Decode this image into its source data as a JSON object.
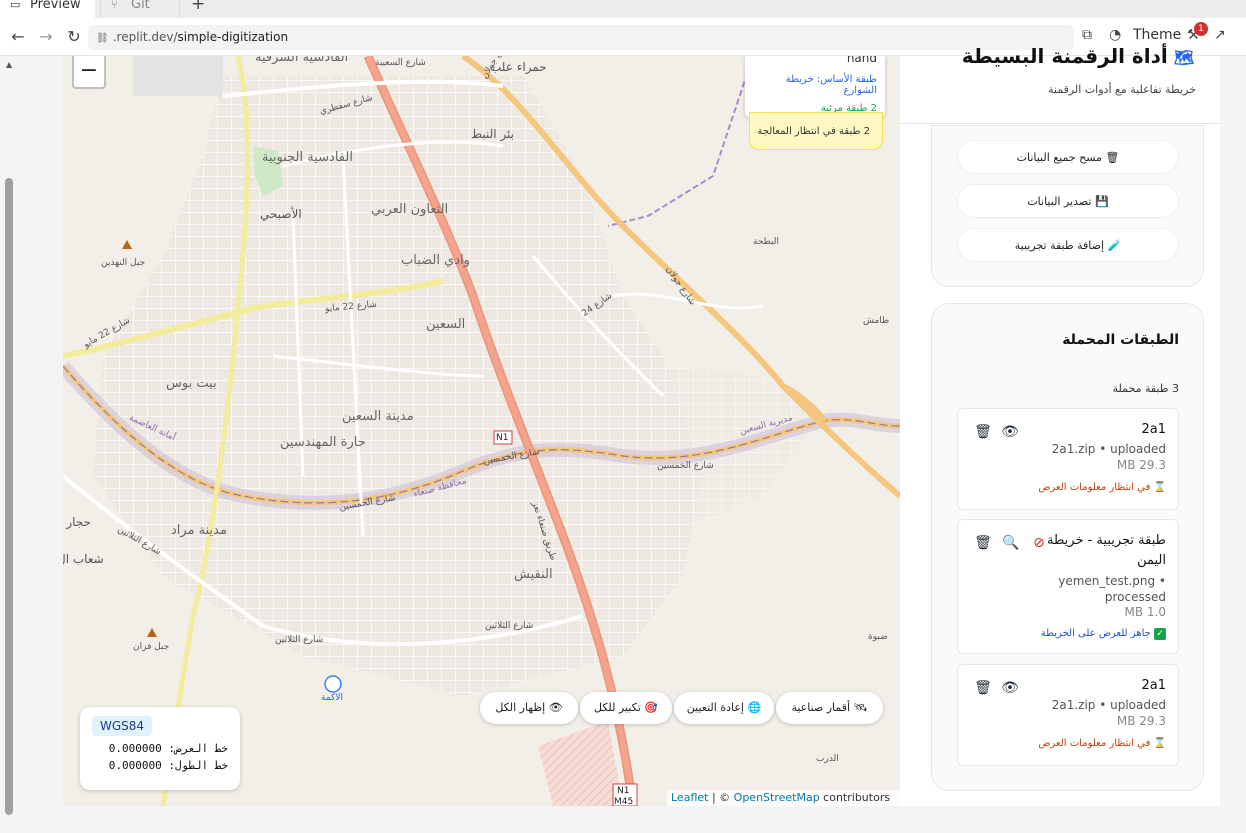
{
  "browser": {
    "tabs": [
      {
        "label": "Preview",
        "icon": "monitor-icon",
        "active": true
      },
      {
        "label": "Git",
        "icon": "git-icon",
        "active": false
      }
    ],
    "url_prefix": ".replit.dev/",
    "url_path": "simple-digitization",
    "theme_label": "Theme",
    "notification_count": "1"
  },
  "map": {
    "zoom_out": "−",
    "info_card": {
      "line1": "hand",
      "line2": "طبقة الأساس: خريطة الشوارع",
      "line3": "2 طبقة مرئية"
    },
    "pending_card": "2 طبقة في انتظار المعالجة",
    "buttons": {
      "show_all": "إظهار الكل",
      "fit_all": "تكبير للكل",
      "reset": "إعادة التعيين",
      "satellite": "أقمار صناعية"
    },
    "coords": {
      "crs": "WGS84",
      "lat_label": "خط العرض:",
      "lat_value": "0.000000",
      "lon_label": "خط الطول:",
      "lon_value": "0.000000"
    },
    "attribution": {
      "leaflet": "Leaflet",
      "sep": " | © ",
      "osm": "OpenStreetMap",
      "contributors": " contributors"
    },
    "labels": {
      "qadisiya_east": "القادسية الشرقية",
      "sawadi_st": "شارع السعيبة",
      "hamra_alab": "حمراء علب",
      "jolan_st": "شارع جولان",
      "sattary_st": "شارع سفطري",
      "bir_nabt": "بئر النبط",
      "qadisiya_south": "القادسية الجنوبية",
      "asbahi": "الأصبحي",
      "taawun": "التعاون العربي",
      "jabal_nahdain": "جبل النهدين",
      "wadi_dhabab": "وادي الضباب",
      "batha": "البطحة",
      "st_22_may": "شارع 22 مايو",
      "st_22_may_2": "شارع 22 مايو",
      "saween": "السعين",
      "tamesh": "طامش",
      "bait_bous": "بيت بوس",
      "saween_city": "مدينة السعين",
      "engineers": "حارة المهندسين",
      "capital": "أمانة العاصمة",
      "saween_dir": "مديرية السعين",
      "fifties_st": "شارع الخمسين",
      "fifties_st2": "شارع الخمسين",
      "fifties_st3": "شارع الخمسين",
      "sanaa_gov": "محافظة صنعاء",
      "hajar": "حجار نو",
      "murad": "مدينة مراد",
      "shaab": "شعاب ال",
      "nuqaish": "النقيش",
      "thalatheen": "شارع الثلاثين",
      "thalatheen2": "شارع الثلاثين",
      "thalatheen3": "شارع الثلاثين",
      "jabal_fazan": "جبل فزان",
      "akama": "الاكمة",
      "darb": "الدرب",
      "dhawa": "ضبوة",
      "st_24": "شارع 24",
      "n1": "N1",
      "n1b": "N1",
      "m45": "M45",
      "taiz_rd": "طريق صنعاء تعز"
    }
  },
  "panel": {
    "title": "أداة الرقمنة البسيطة",
    "subtitle": "خريطة تفاعلية مع أدوات الرقمنة",
    "actions": {
      "clear": "مسح جميع البيانات",
      "export": "تصدير البيانات",
      "add_test": "إضافة طبقة تجريبية"
    },
    "layers_title": "الطبقات المحملة",
    "layers_count": "3 طبقة محملة",
    "layers": [
      {
        "name": "2a1",
        "meta": "2a1.zip • uploaded",
        "size": "29.3 MB",
        "status": "في انتظار معلومات العرض",
        "status_icon": "hourglass-icon"
      },
      {
        "name": "طبقة تجريبية - خريطة اليمن",
        "meta": "yemen_test.png • processed",
        "size": "1.0 MB",
        "status": "جاهز للعرض على الخريطة",
        "status_icon": "check-icon"
      },
      {
        "name": "2a1",
        "meta": "2a1.zip • uploaded",
        "size": "29.3 MB",
        "status": "في انتظار معلومات العرض",
        "status_icon": "hourglass-icon"
      }
    ]
  }
}
